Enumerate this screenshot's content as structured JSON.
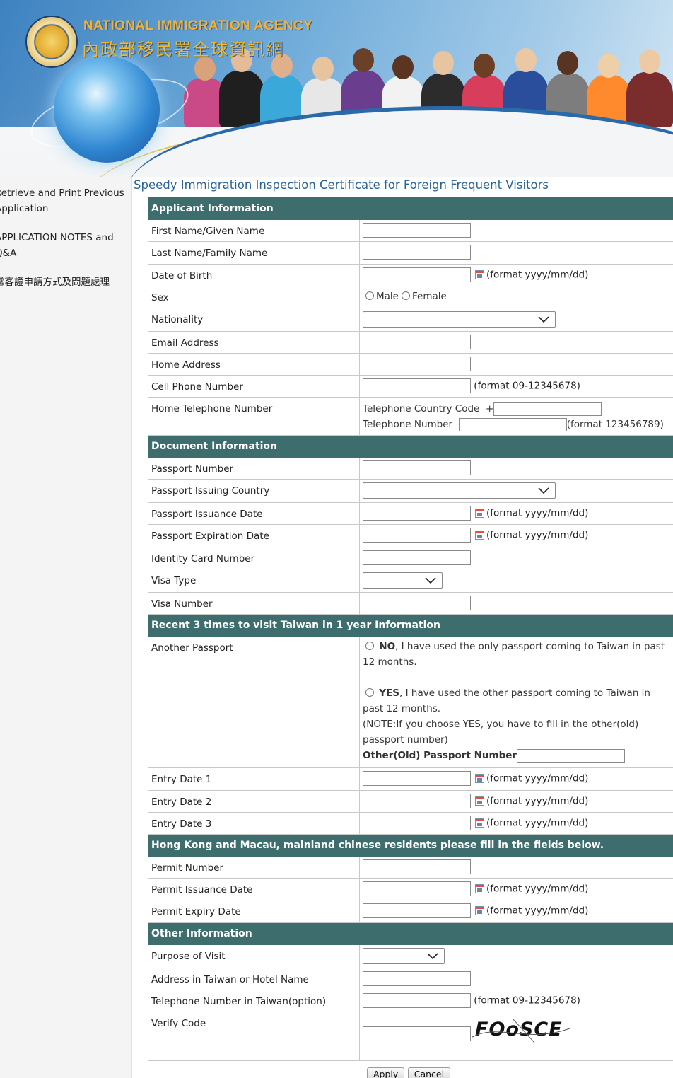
{
  "header": {
    "agency_en": "NATIONAL IMMIGRATION AGENCY",
    "agency_zh": "內政部移民署全球資訊網"
  },
  "sidebar": {
    "items": [
      {
        "line1": "Retrieve and Print Previous",
        "line2": "Application"
      },
      {
        "line1": "APPLICATION NOTES and",
        "line2": "Q&A"
      },
      {
        "line1": "常客證申請方式及問題處理",
        "line2": ""
      }
    ]
  },
  "page_title": "Speedy Immigration Inspection Certificate for Foreign Frequent Visitors",
  "format_date": "(format yyyy/mm/dd)",
  "format_cell": "(format 09-12345678)",
  "sections": {
    "applicant": "Applicant Information",
    "document": "Document Information",
    "recent": "Recent 3 times to visit Taiwan in 1 year Information",
    "hkmacau": "Hong Kong and Macau, mainland chinese residents please fill in the fields below.",
    "other": "Other Information"
  },
  "labels": {
    "first_name": "First Name/Given Name",
    "last_name": "Last Name/Family Name",
    "dob": "Date of Birth",
    "sex": "Sex",
    "nationality": "Nationality",
    "email": "Email Address",
    "home_address": "Home Address",
    "cell_phone": "Cell Phone Number",
    "home_tel": "Home Telephone Number",
    "passport_number": "Passport Number",
    "passport_country": "Passport Issuing Country",
    "passport_issue": "Passport Issuance Date",
    "passport_expiry": "Passport Expiration Date",
    "id_card": "Identity Card Number",
    "visa_type": "Visa Type",
    "visa_number": "Visa Number",
    "another_passport": "Another Passport",
    "entry1": "Entry Date 1",
    "entry2": "Entry Date 2",
    "entry3": "Entry Date 3",
    "permit_number": "Permit Number",
    "permit_issue": "Permit Issuance Date",
    "permit_expiry": "Permit Expiry Date",
    "purpose": "Purpose of Visit",
    "address_taiwan": "Address in Taiwan or Hotel Name",
    "tel_taiwan": "Telephone Number in Taiwan(option)",
    "verify": "Verify Code"
  },
  "sex_options": {
    "male": "Male",
    "female": "Female"
  },
  "home_tel": {
    "country_code_label": "Telephone Country Code",
    "plus": "+",
    "number_label": "Telephone Number",
    "format": "(format 123456789)"
  },
  "another_passport": {
    "no_bold": "NO",
    "no_line1": ", I have used the only passport coming to Taiwan in past",
    "no_line2": "12 months.",
    "yes_bold": "YES",
    "yes_line1": ", I have used the other passport coming to Taiwan in",
    "yes_line2": "past 12 months.",
    "note_line1": "(NOTE:If you choose YES, you have to fill in the other(old)",
    "note_line2": "passport number)",
    "old_label": "Other(Old) Passport Number"
  },
  "captcha_text": "FOoSCE",
  "buttons": {
    "apply": "Apply",
    "cancel": "Cancel"
  },
  "colors": {
    "section_bg": "#3e6d6d",
    "title": "#2a6496",
    "agency_gold": "#f2b233"
  }
}
